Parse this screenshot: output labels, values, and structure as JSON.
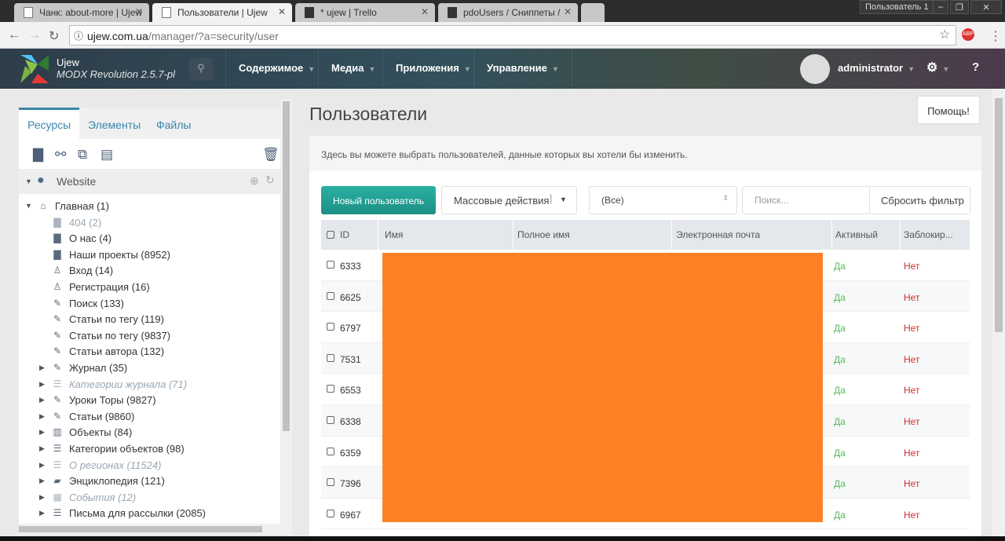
{
  "browser": {
    "tabs": [
      {
        "label": "Чанк: about-more | Ujew"
      },
      {
        "label": "Пользователи | Ujew",
        "active": true
      },
      {
        "label": "* ujew | Trello"
      },
      {
        "label": "pdoUsers / Сниппеты / "
      }
    ],
    "profile": "Пользователь 1",
    "url_host": "ujew.com.ua",
    "url_path": "/manager/?a=security/user"
  },
  "header": {
    "site_name": "Ujew",
    "version": "MODX Revolution 2.5.7-pl",
    "menu": [
      "Содержимое",
      "Медиа",
      "Приложения",
      "Управление"
    ],
    "user": "administrator"
  },
  "left": {
    "tabs": [
      "Ресурсы",
      "Элементы",
      "Файлы"
    ],
    "context": "Website",
    "tree": [
      {
        "label": "Главная (1)",
        "icon": "home-icon",
        "level": 0,
        "arrow": "down"
      },
      {
        "label": "404 (2)",
        "icon": "document-icon",
        "level": 1,
        "style": "muted"
      },
      {
        "label": "О нас (4)",
        "icon": "document-icon",
        "level": 1
      },
      {
        "label": "Наши проекты (8952)",
        "icon": "document-icon",
        "level": 1
      },
      {
        "label": "Вход (14)",
        "icon": "user-icon",
        "level": 1
      },
      {
        "label": "Регистрация (16)",
        "icon": "user-icon",
        "level": 1
      },
      {
        "label": "Поиск (133)",
        "icon": "pencil-icon",
        "level": 1
      },
      {
        "label": "Статьи по тегу (119)",
        "icon": "pencil-icon",
        "level": 1
      },
      {
        "label": "Статьи по тегу (9837)",
        "icon": "pencil-icon",
        "level": 1
      },
      {
        "label": "Статьи автора (132)",
        "icon": "pencil-icon",
        "level": 1
      },
      {
        "label": "Журнал (35)",
        "icon": "pencil-icon",
        "level": 1,
        "arrow": "right"
      },
      {
        "label": "Категории журнала (71)",
        "icon": "list-icon",
        "level": 1,
        "arrow": "right",
        "style": "italic"
      },
      {
        "label": "Уроки Торы (9827)",
        "icon": "pencil-icon",
        "level": 1,
        "arrow": "right"
      },
      {
        "label": "Статьи (9860)",
        "icon": "pencil-icon",
        "level": 1,
        "arrow": "right"
      },
      {
        "label": "Объекты (84)",
        "icon": "building-icon",
        "level": 1,
        "arrow": "right"
      },
      {
        "label": "Категории объектов (98)",
        "icon": "list-icon",
        "level": 1,
        "arrow": "right"
      },
      {
        "label": "О регионах (11524)",
        "icon": "list-icon",
        "level": 1,
        "arrow": "right",
        "style": "italic"
      },
      {
        "label": "Энциклопедия (121)",
        "icon": "book-icon",
        "level": 1,
        "arrow": "right"
      },
      {
        "label": "События (12)",
        "icon": "calendar-icon",
        "level": 1,
        "arrow": "right",
        "style": "italic"
      },
      {
        "label": "Письма для рассылки (2085)",
        "icon": "list-icon",
        "level": 1,
        "arrow": "right"
      }
    ]
  },
  "main": {
    "title": "Пользователи",
    "help": "Помощь!",
    "description": "Здесь вы можете выбрать пользователей, данные которых вы хотели бы изменить.",
    "new_user": "Новый пользователь",
    "bulk_actions": "Массовые действия",
    "filter_value": "(Все)",
    "search_placeholder": "Поиск...",
    "reset_filter": "Сбросить фильтр",
    "columns": [
      "ID",
      "Имя",
      "Полное имя",
      "Электронная почта",
      "Активный",
      "Заблокир..."
    ],
    "rows": [
      {
        "id": "6333",
        "active": "Да",
        "blocked": "Нет"
      },
      {
        "id": "6625",
        "active": "Да",
        "blocked": "Нет"
      },
      {
        "id": "6797",
        "active": "Да",
        "blocked": "Нет"
      },
      {
        "id": "7531",
        "active": "Да",
        "blocked": "Нет"
      },
      {
        "id": "6553",
        "active": "Да",
        "blocked": "Нет"
      },
      {
        "id": "6338",
        "active": "Да",
        "blocked": "Нет"
      },
      {
        "id": "6359",
        "active": "Да",
        "blocked": "Нет"
      },
      {
        "id": "7396",
        "active": "Да",
        "blocked": "Нет"
      },
      {
        "id": "6967",
        "active": "Да",
        "blocked": "Нет"
      }
    ]
  },
  "colors": {
    "accent": "#26a69a",
    "link": "#3a87ad",
    "redaction": "#fe8225",
    "yes": "#5cb85c",
    "no": "#c9302c"
  }
}
